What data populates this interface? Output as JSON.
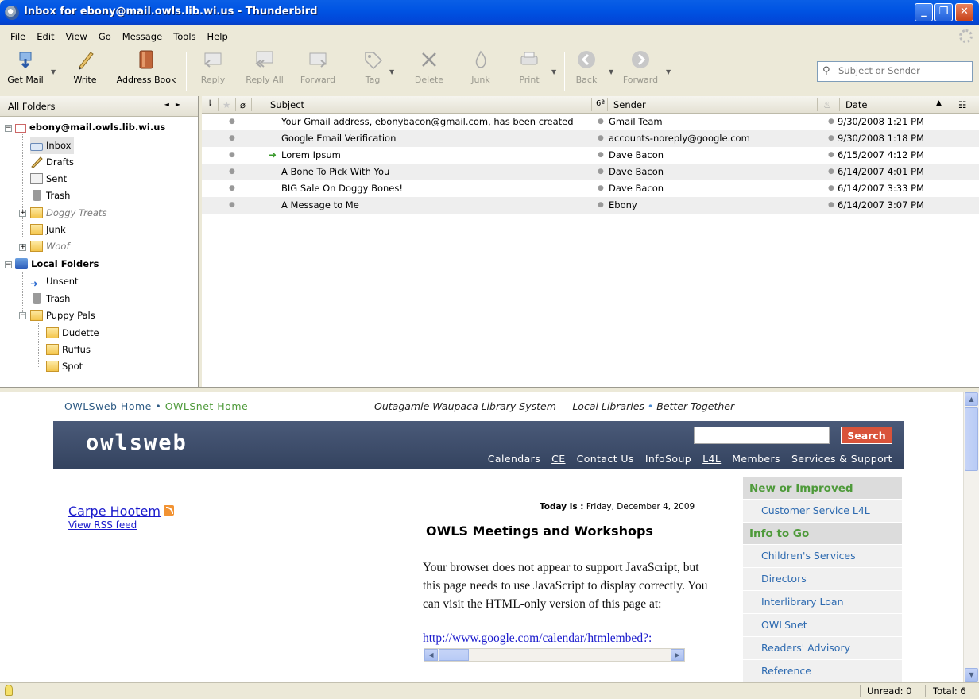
{
  "window": {
    "title": "Inbox for ebony@mail.owls.lib.wi.us - Thunderbird"
  },
  "menu": [
    "File",
    "Edit",
    "View",
    "Go",
    "Message",
    "Tools",
    "Help"
  ],
  "toolbar": {
    "get_mail": "Get Mail",
    "write": "Write",
    "address_book": "Address Book",
    "reply": "Reply",
    "reply_all": "Reply All",
    "forward": "Forward",
    "tag": "Tag",
    "delete": "Delete",
    "junk": "Junk",
    "print": "Print",
    "back": "Back",
    "forward_nav": "Forward",
    "search_placeholder": "Subject or Sender"
  },
  "folders": {
    "header": "All Folders",
    "account": "ebony@mail.owls.lib.wi.us",
    "inbox": "Inbox",
    "drafts": "Drafts",
    "sent": "Sent",
    "trash": "Trash",
    "doggy_treats": "Doggy Treats",
    "junk": "Junk",
    "woof": "Woof",
    "local_folders": "Local Folders",
    "unsent": "Unsent",
    "local_trash": "Trash",
    "puppy_pals": "Puppy Pals",
    "dudette": "Dudette",
    "ruffus": "Ruffus",
    "spot": "Spot"
  },
  "thread_columns": {
    "subject": "Subject",
    "sender": "Sender",
    "date": "Date"
  },
  "messages": [
    {
      "subject": "Your Gmail address, ebonybacon@gmail.com, has been created",
      "sender": "Gmail Team",
      "date": "9/30/2008 1:21 PM"
    },
    {
      "subject": "Google Email Verification",
      "sender": "accounts-noreply@google.com",
      "date": "9/30/2008 1:18 PM"
    },
    {
      "subject": "Lorem Ipsum",
      "sender": "Dave Bacon",
      "date": "6/15/2007 4:12 PM",
      "replied": true
    },
    {
      "subject": "A Bone To Pick With You",
      "sender": "Dave Bacon",
      "date": "6/14/2007 4:01 PM"
    },
    {
      "subject": "BIG Sale On Doggy Bones!",
      "sender": "Dave Bacon",
      "date": "6/14/2007 3:33 PM"
    },
    {
      "subject": "A Message to Me",
      "sender": "Ebony",
      "date": "6/14/2007 3:07 PM"
    }
  ],
  "webpage": {
    "home_link": "OWLSweb Home",
    "bullet": "•",
    "owlsnet_link": "OWLSnet Home",
    "tagline_1": "Outagamie Waupaca Library System — Local Libraries",
    "tagline_dot": "•",
    "tagline_2": "Better Together",
    "logo": "owlsweb",
    "search_button": "Search",
    "nav": [
      "Calendars",
      "CE",
      "Contact Us",
      "InfoSoup",
      "L4L",
      "Members",
      "Services & Support"
    ],
    "carpe": "Carpe Hootem",
    "view_rss": "View RSS feed",
    "today_label": "Today is :",
    "today_value": "Friday, December 4, 2009",
    "meetings_title": "OWLS Meetings and Workshops",
    "js_text": "Your browser does not appear to support JavaScript, but this page needs to use JavaScript to display correctly. You can visit the HTML-only version of this page at:",
    "js_link": "http://www.google.com/calendar/htmlembed?:",
    "sidebar": {
      "head1": "New or Improved",
      "item1": "Customer Service L4L",
      "head2": "Info to Go",
      "items": [
        "Children's Services",
        "Directors",
        "Interlibrary Loan",
        "OWLSnet",
        "Readers' Advisory",
        "Reference"
      ]
    }
  },
  "status": {
    "unread": "Unread: 0",
    "total": "Total: 6"
  }
}
